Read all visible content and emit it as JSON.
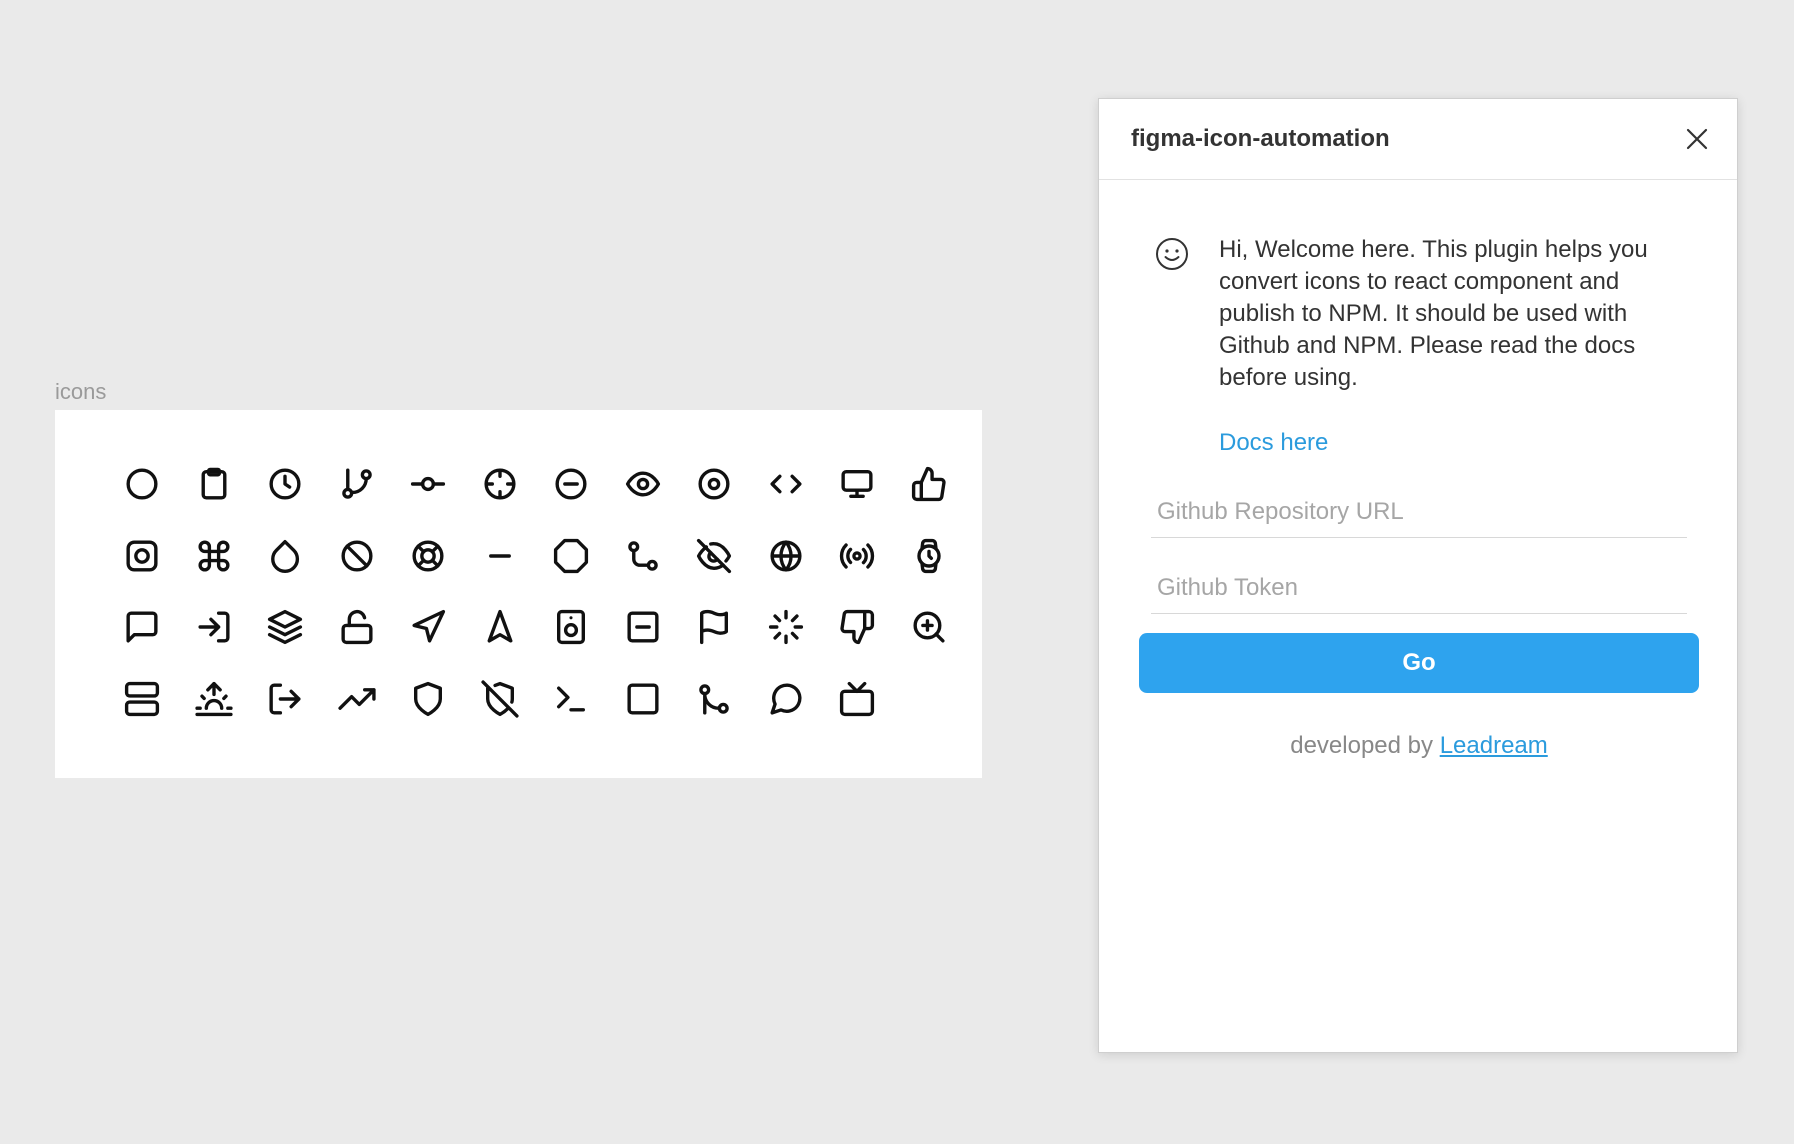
{
  "canvas": {
    "frame_label": "icons",
    "icons": [
      [
        "circle-icon",
        "clipboard-icon",
        "clock-icon",
        "git-branch-icon",
        "git-commit-icon",
        "crosshair-icon",
        "minus-circle-icon",
        "eye-icon",
        "disc-icon",
        "code-icon",
        "monitor-icon",
        "thumbs-up-icon"
      ],
      [
        "instagram-icon",
        "command-icon",
        "droplet-icon",
        "slash-icon",
        "life-buoy-icon",
        "minus-icon",
        "octagon-icon",
        "git-pull-request-icon",
        "eye-off-icon",
        "globe-icon",
        "radio-icon",
        "watch-icon"
      ],
      [
        "message-square-icon",
        "log-in-icon",
        "layers-icon",
        "unlock-icon",
        "navigation-icon",
        "navigation-2-icon",
        "speaker-icon",
        "minus-square-icon",
        "flag-icon",
        "loader-icon",
        "thumbs-down-icon",
        "zoom-in-icon"
      ],
      [
        "server-icon",
        "sunrise-icon",
        "log-out-icon",
        "trending-up-icon",
        "shield-icon",
        "shield-off-icon",
        "terminal-icon",
        "square-icon",
        "git-merge-icon",
        "message-circle-icon",
        "tv-icon"
      ]
    ]
  },
  "plugin": {
    "title": "figma-icon-automation",
    "welcome_text": "Hi, Welcome here. This plugin helps you convert icons to react component and publish to NPM. It should be used with Github and NPM. Please read the docs before using.",
    "docs_link": "Docs here",
    "repo_placeholder": "Github Repository URL",
    "repo_value": "",
    "token_placeholder": "Github Token",
    "token_value": "",
    "go_label": "Go",
    "credit_prefix": "developed by ",
    "credit_link": "Leadream",
    "accent_color": "#2ea3ee"
  }
}
